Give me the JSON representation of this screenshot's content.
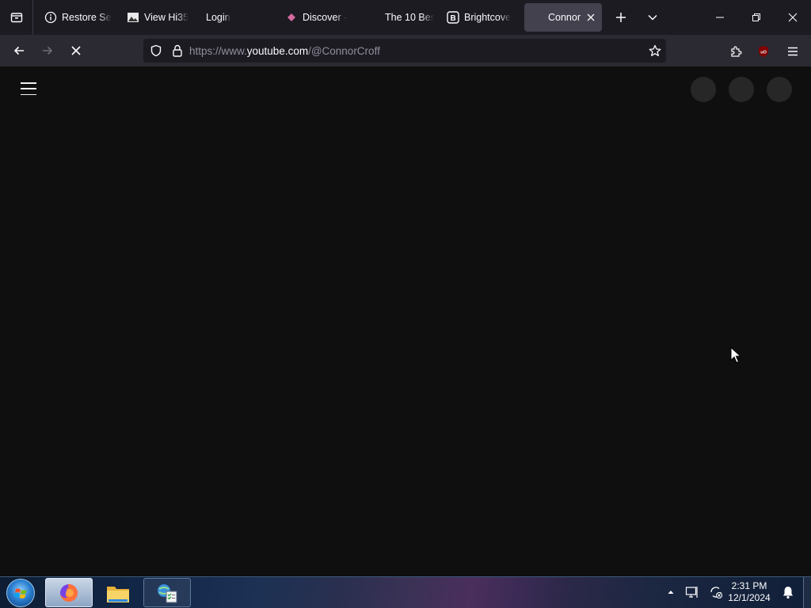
{
  "browser": {
    "tabs": [
      {
        "label": "Restore Se",
        "icon": "info-icon"
      },
      {
        "label": "View Hi35",
        "icon": "image-favicon"
      },
      {
        "label": "Login",
        "icon": "none"
      },
      {
        "label": "Discover -",
        "icon": "diamond-favicon"
      },
      {
        "label": "The 10 Bes",
        "icon": "moon-favicon"
      },
      {
        "label": "Brightcove",
        "icon": "brightcove-favicon"
      },
      {
        "label": "Connor",
        "icon": "none",
        "active": true
      }
    ],
    "url": {
      "prefix": "https://www.",
      "host": "youtube.com",
      "path": "/@ConnorCroff"
    }
  },
  "taskbar": {
    "time": "2:31 PM",
    "date": "12/1/2024",
    "apps": [
      "firefox-icon",
      "file-explorer-icon",
      "control-panel-icon"
    ]
  },
  "colors": {
    "page_bg": "#0f0f0f",
    "tabstrip_bg": "#1c1b22",
    "navbar_bg": "#2b2a33",
    "placeholder": "#272727",
    "ublock_red": "#800000"
  }
}
